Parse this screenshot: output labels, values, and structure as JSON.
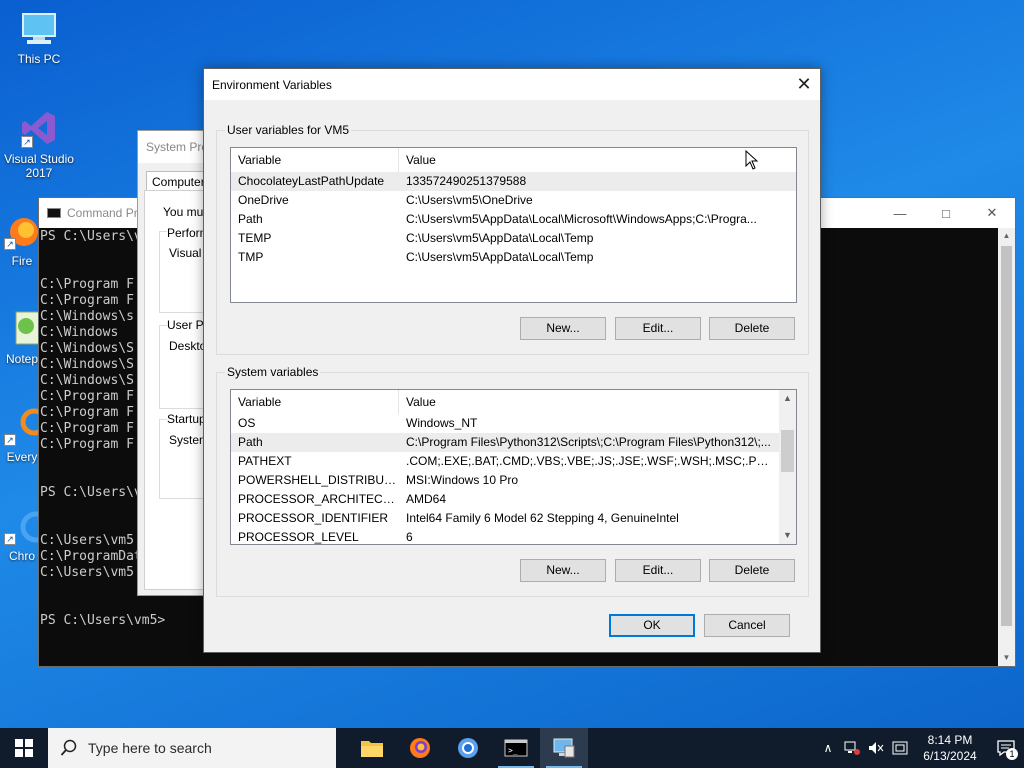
{
  "desktop": {
    "icons": [
      {
        "label": "This PC"
      },
      {
        "label": "Visual Studio 2017"
      },
      {
        "label": "Fire"
      },
      {
        "label": "Notep"
      },
      {
        "label": "Every"
      },
      {
        "label": "Chro"
      }
    ]
  },
  "terminal": {
    "title": "Command Pr",
    "lines": [
      "PS C:\\Users\\v",
      "",
      "",
      "C:\\Program F",
      "C:\\Program F",
      "C:\\Windows\\s",
      "C:\\Windows",
      "C:\\Windows\\S",
      "C:\\Windows\\S",
      "C:\\Windows\\S",
      "C:\\Program F",
      "C:\\Program F",
      "C:\\Program F",
      "C:\\Program F",
      "",
      "",
      "PS C:\\Users\\v",
      "",
      "",
      "C:\\Users\\vm5",
      "C:\\ProgramDat",
      "C:\\Users\\vm5",
      "",
      "",
      "PS C:\\Users\\vm5>"
    ]
  },
  "system_properties": {
    "title": "System Pro",
    "tab": "Computer N",
    "text_must": "You mus",
    "perf_label": "Perform",
    "perf_text": "Visual e",
    "user_label": "User Pr",
    "user_text": "Desktop",
    "startup_label": "Startup",
    "startup_text": "System"
  },
  "env_dialog": {
    "title": "Environment Variables",
    "user_group_label": "User variables for VM5",
    "system_group_label": "System variables",
    "col_variable": "Variable",
    "col_value": "Value",
    "user_vars": [
      {
        "name": "ChocolateyLastPathUpdate",
        "value": "133572490251379588"
      },
      {
        "name": "OneDrive",
        "value": "C:\\Users\\vm5\\OneDrive"
      },
      {
        "name": "Path",
        "value": "C:\\Users\\vm5\\AppData\\Local\\Microsoft\\WindowsApps;C:\\Progra..."
      },
      {
        "name": "TEMP",
        "value": "C:\\Users\\vm5\\AppData\\Local\\Temp"
      },
      {
        "name": "TMP",
        "value": "C:\\Users\\vm5\\AppData\\Local\\Temp"
      }
    ],
    "system_vars": [
      {
        "name": "OS",
        "value": "Windows_NT"
      },
      {
        "name": "Path",
        "value": "C:\\Program Files\\Python312\\Scripts\\;C:\\Program Files\\Python312\\;..."
      },
      {
        "name": "PATHEXT",
        "value": ".COM;.EXE;.BAT;.CMD;.VBS;.VBE;.JS;.JSE;.WSF;.WSH;.MSC;.PY;.PYW"
      },
      {
        "name": "POWERSHELL_DISTRIBUTIO...",
        "value": "MSI:Windows 10 Pro"
      },
      {
        "name": "PROCESSOR_ARCHITECTURE",
        "value": "AMD64"
      },
      {
        "name": "PROCESSOR_IDENTIFIER",
        "value": "Intel64 Family 6 Model 62 Stepping 4, GenuineIntel"
      },
      {
        "name": "PROCESSOR_LEVEL",
        "value": "6"
      }
    ],
    "buttons": {
      "new": "New...",
      "edit": "Edit...",
      "delete": "Delete",
      "ok": "OK",
      "cancel": "Cancel"
    }
  },
  "taskbar": {
    "search_placeholder": "Type here to search",
    "time": "8:14 PM",
    "date": "6/13/2024",
    "notification_count": "1"
  },
  "colors": {
    "accent": "#0078d7",
    "taskbar": "#101c2b",
    "desktop": "#1f8ae8"
  }
}
